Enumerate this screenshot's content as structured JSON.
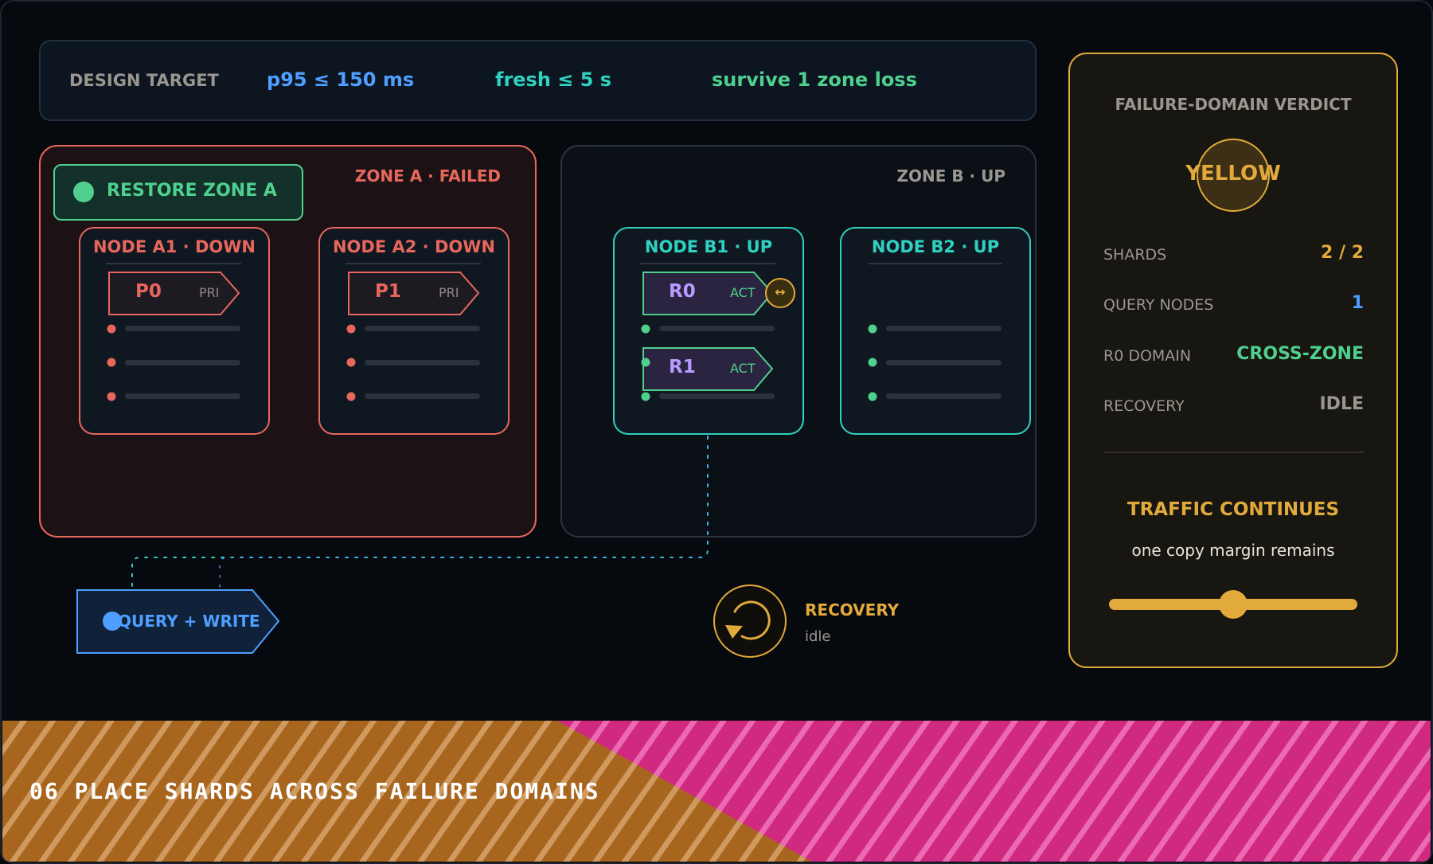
{
  "colors": {
    "page_bg": "#06090d",
    "panel_bg": "#0c1520",
    "panel_border": "#223040",
    "failed_red": "#e8675d",
    "failed_bg": "#1c1215",
    "up_teal": "#2fd1c0",
    "green": "#4fd08e",
    "blue": "#4e9fff",
    "purple": "#b89cff",
    "amber": "#e2aa3a",
    "muted": "#9a9690",
    "footer_gold": "#a8651d",
    "footer_pink": "#d02980"
  },
  "design_target": {
    "label": "DESIGN TARGET",
    "items": [
      "p95 ≤ 150 ms",
      "fresh ≤ 5 s",
      "survive 1 zone loss"
    ]
  },
  "zone_a": {
    "title": "ZONE A · FAILED",
    "restore_button": "RESTORE ZONE A",
    "nodes": [
      {
        "title": "NODE A1 · DOWN",
        "shard": "P0",
        "role": "PRI"
      },
      {
        "title": "NODE A2 · DOWN",
        "shard": "P1",
        "role": "PRI"
      }
    ]
  },
  "zone_b": {
    "title": "ZONE B · UP",
    "nodes": [
      {
        "title": "NODE B1 · UP",
        "shards": [
          {
            "name": "R0",
            "role": "ACT"
          },
          {
            "name": "R1",
            "role": "ACT"
          }
        ],
        "swap_icon": "↔"
      },
      {
        "title": "NODE B2 · UP"
      }
    ]
  },
  "query_button": "QUERY + WRITE",
  "recovery": {
    "label": "RECOVERY",
    "status": "idle"
  },
  "verdict": {
    "title": "FAILURE-DOMAIN VERDICT",
    "status": "YELLOW",
    "rows": [
      {
        "label": "SHARDS",
        "value": "2 / 2"
      },
      {
        "label": "QUERY NODES",
        "value": "1"
      },
      {
        "label": "R0 DOMAIN",
        "value": "CROSS-ZONE"
      },
      {
        "label": "RECOVERY",
        "value": "IDLE"
      }
    ],
    "headline": "TRAFFIC CONTINUES",
    "subline": "one copy margin remains",
    "slider_fraction": 0.5
  },
  "footer": {
    "title": "06 PLACE SHARDS ACROSS FAILURE DOMAINS"
  }
}
